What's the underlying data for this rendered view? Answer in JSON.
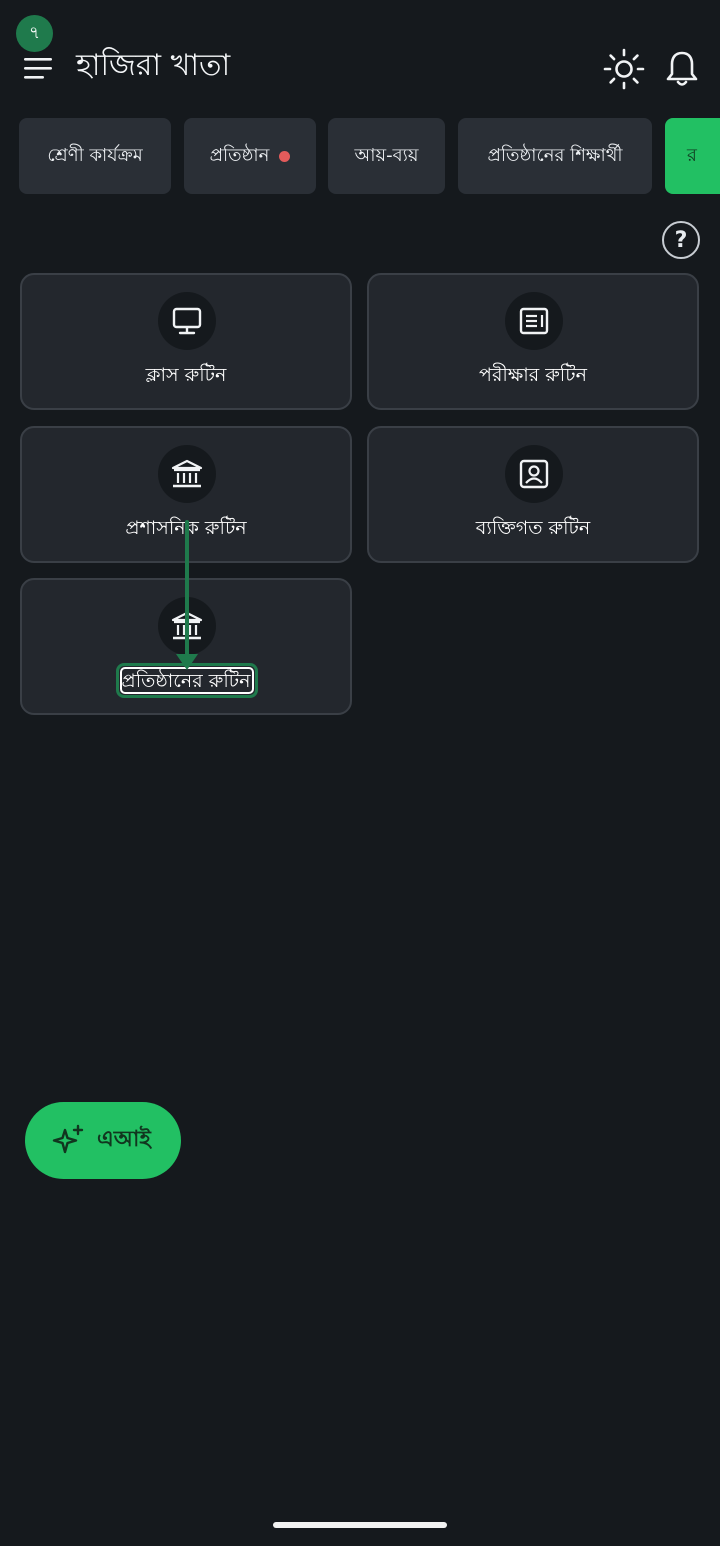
{
  "step_badge": "৭",
  "header": {
    "title": "হাজিরা খাতা",
    "menu_icon": "hamburger-menu-icon",
    "theme_icon": "sun-icon",
    "notification_icon": "bell-icon"
  },
  "tabs": [
    {
      "label": "শ্রেণী কার্যক্রম",
      "has_dot": false,
      "active": false
    },
    {
      "label": "প্রতিষ্ঠান",
      "has_dot": true,
      "active": false
    },
    {
      "label": "আয়-ব্যয়",
      "has_dot": false,
      "active": false
    },
    {
      "label": "প্রতিষ্ঠানের শিক্ষার্থী",
      "has_dot": false,
      "active": false
    },
    {
      "label": "র",
      "has_dot": false,
      "active": true
    }
  ],
  "help_label": "?",
  "cards": [
    {
      "label": "ক্লাস রুটিন",
      "icon": "monitor-icon"
    },
    {
      "label": "পরীক্ষার রুটিন",
      "icon": "document-list-icon"
    },
    {
      "label": "প্রশাসনিক রুটিন",
      "icon": "bank-building-icon"
    },
    {
      "label": "ব্যক্তিগত রুটিন",
      "icon": "person-frame-icon"
    },
    {
      "label": "প্রতিষ্ঠানের রুটিন",
      "icon": "bank-building-icon"
    }
  ],
  "ai_button": {
    "label": "এআই",
    "icon": "sparkle-icon"
  },
  "colors": {
    "background": "#15191d",
    "card": "#23272d",
    "accent_green": "#22c063",
    "annotation_green": "#1f7a4c",
    "notification_dot": "#e35b5b"
  }
}
